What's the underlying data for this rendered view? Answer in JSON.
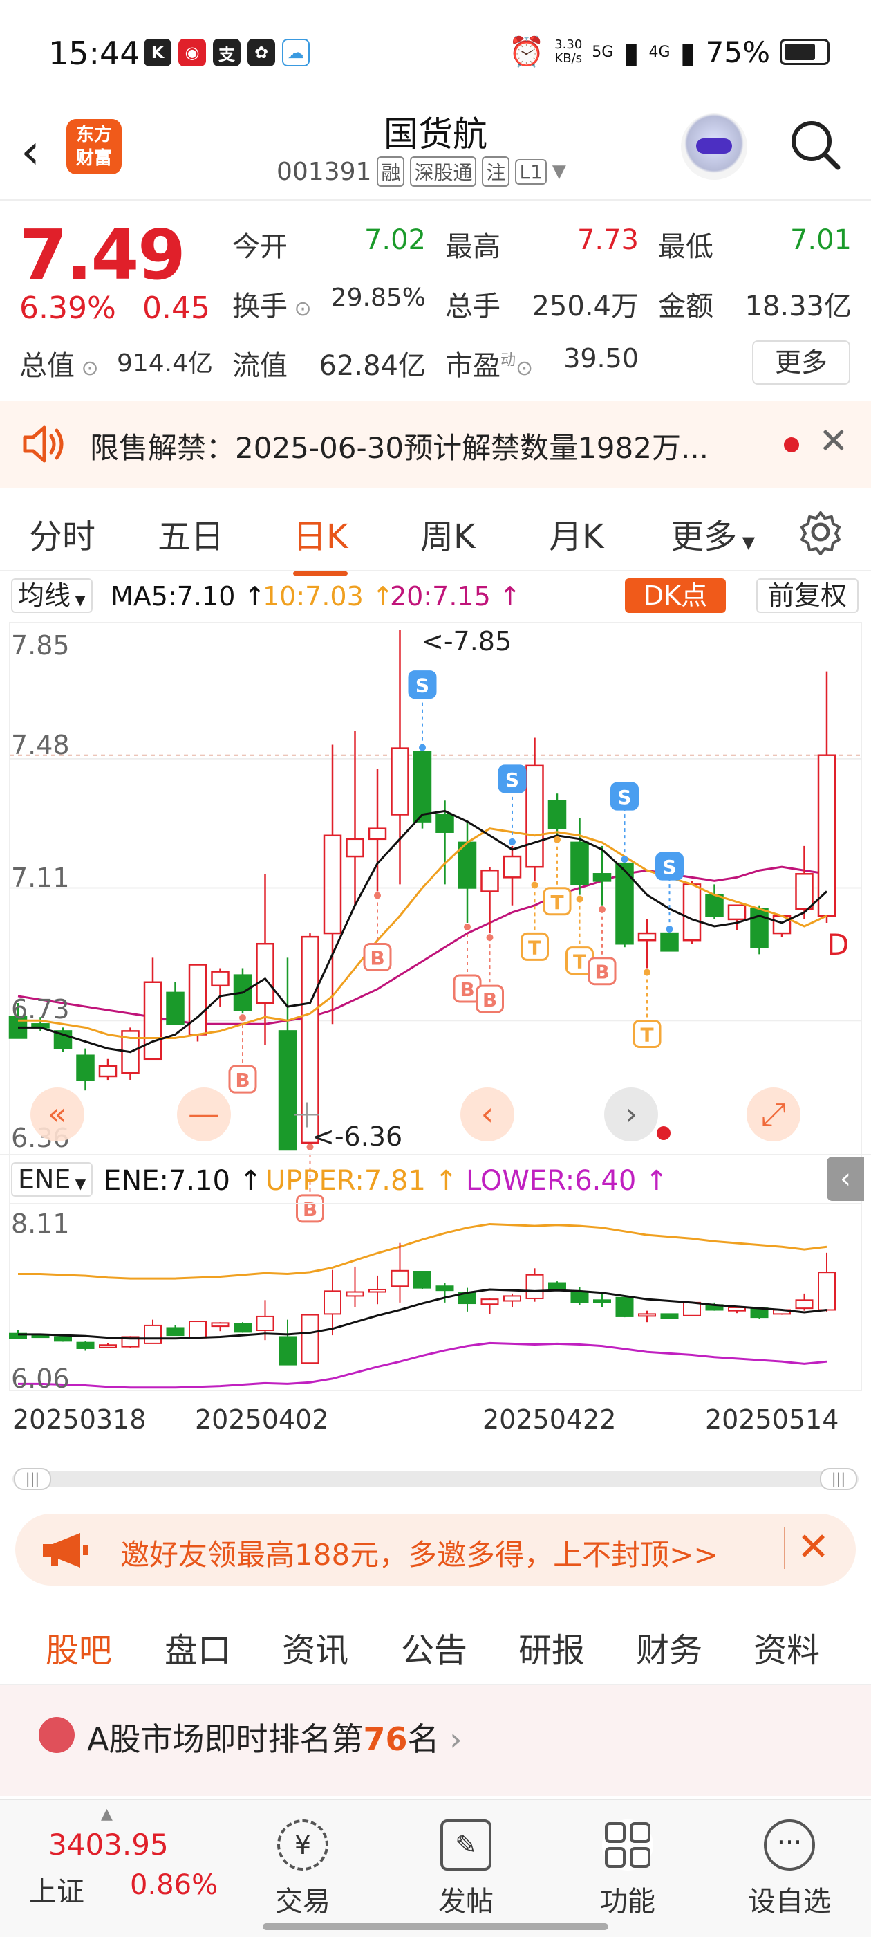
{
  "status": {
    "time": "15:44",
    "net_speed": "3.30",
    "net_unit": "KB/s",
    "net_5g": "5G",
    "net_4g": "4G",
    "battery": "75%"
  },
  "header": {
    "logo_line1": "东方",
    "logo_line2": "财富",
    "stock_name": "国货航",
    "stock_code": "001391",
    "tags": [
      "融",
      "深股通",
      "注",
      "L1"
    ]
  },
  "quote": {
    "price": "7.49",
    "change_pct": "6.39%",
    "change_amt": "0.45",
    "open_label": "今开",
    "open": "7.02",
    "high_label": "最高",
    "high": "7.73",
    "low_label": "最低",
    "low": "7.01",
    "turnover_rate_label": "换手",
    "turnover_rate": "29.85%",
    "volume_label": "总手",
    "volume": "250.4万",
    "amount_label": "金额",
    "amount": "18.33亿",
    "total_cap_label": "总值",
    "total_cap": "914.4亿",
    "float_cap_label": "流值",
    "float_cap": "62.84亿",
    "pe_label": "市盈",
    "pe_sup": "动",
    "pe": "39.50",
    "more": "更多"
  },
  "notice": {
    "text": "限售解禁：2025-06-30预计解禁数量1982万..."
  },
  "tabs": [
    "分时",
    "五日",
    "日K",
    "周K",
    "月K",
    "更多"
  ],
  "active_tab": "日K",
  "ma_bar": {
    "indicator": "均线",
    "ma5": "MA5:7.10",
    "ma10": "10:7.03",
    "ma20": "20:7.15",
    "dk": "DK点",
    "adjust": "前复权"
  },
  "ene_bar": {
    "indicator": "ENE",
    "ene": "ENE:7.10",
    "upper": "UPPER:7.81",
    "lower": "LOWER:6.40"
  },
  "colors": {
    "up": "#e0202a",
    "down": "#1a9a2a",
    "ma5": "#111111",
    "ma10": "#f0a020",
    "ma20": "#c0147a",
    "accent": "#e8561a",
    "buy": "#f07a6a",
    "sell": "#4a9ef0",
    "t": "#f5a83a"
  },
  "chart_data": {
    "type": "candlestick",
    "price_axis": {
      "top_label": "7.85",
      "mid_label": "7.48",
      "low_mid_label": "7.11",
      "lower_label": "6.73",
      "bottom_label": "6.36",
      "ylim": [
        6.36,
        7.85
      ]
    },
    "high_marker": "<-7.85",
    "low_marker": "<-6.36",
    "end_marker": "D",
    "ene_axis": {
      "top_label": "8.11",
      "bottom_label": "6.06",
      "ylim": [
        6.06,
        8.11
      ]
    },
    "dates": [
      "20250318",
      "20250402",
      "20250422",
      "20250514"
    ],
    "candles": [
      {
        "o": 6.74,
        "h": 6.78,
        "l": 6.69,
        "c": 6.68
      },
      {
        "o": 6.72,
        "h": 6.74,
        "l": 6.7,
        "c": 6.71
      },
      {
        "o": 6.7,
        "h": 6.71,
        "l": 6.64,
        "c": 6.65
      },
      {
        "o": 6.63,
        "h": 6.65,
        "l": 6.53,
        "c": 6.56
      },
      {
        "o": 6.57,
        "h": 6.62,
        "l": 6.56,
        "c": 6.6
      },
      {
        "o": 6.58,
        "h": 6.71,
        "l": 6.56,
        "c": 6.7
      },
      {
        "o": 6.62,
        "h": 6.91,
        "l": 6.62,
        "c": 6.84
      },
      {
        "o": 6.81,
        "h": 6.84,
        "l": 6.72,
        "c": 6.72
      },
      {
        "o": 6.69,
        "h": 6.88,
        "l": 6.67,
        "c": 6.89
      },
      {
        "o": 6.83,
        "h": 6.88,
        "l": 6.77,
        "c": 6.87
      },
      {
        "o": 6.86,
        "h": 6.88,
        "l": 6.75,
        "c": 6.76
      },
      {
        "o": 6.78,
        "h": 7.15,
        "l": 6.66,
        "c": 6.95
      },
      {
        "o": 6.7,
        "h": 6.91,
        "l": 6.36,
        "c": 6.36
      },
      {
        "o": 6.38,
        "h": 6.98,
        "l": 6.38,
        "c": 6.97
      },
      {
        "o": 6.98,
        "h": 7.52,
        "l": 6.72,
        "c": 7.26
      },
      {
        "o": 7.2,
        "h": 7.56,
        "l": 7.06,
        "c": 7.25
      },
      {
        "o": 7.25,
        "h": 7.45,
        "l": 7.1,
        "c": 7.28
      },
      {
        "o": 7.32,
        "h": 7.85,
        "l": 7.12,
        "c": 7.51
      },
      {
        "o": 7.5,
        "h": 7.5,
        "l": 7.28,
        "c": 7.3
      },
      {
        "o": 7.32,
        "h": 7.36,
        "l": 7.12,
        "c": 7.27
      },
      {
        "o": 7.24,
        "h": 7.3,
        "l": 7.01,
        "c": 7.11
      },
      {
        "o": 7.1,
        "h": 7.17,
        "l": 6.98,
        "c": 7.16
      },
      {
        "o": 7.14,
        "h": 7.23,
        "l": 7.06,
        "c": 7.2
      },
      {
        "o": 7.17,
        "h": 7.54,
        "l": 7.13,
        "c": 7.46
      },
      {
        "o": 7.36,
        "h": 7.38,
        "l": 7.26,
        "c": 7.28
      },
      {
        "o": 7.24,
        "h": 7.31,
        "l": 7.09,
        "c": 7.12
      },
      {
        "o": 7.15,
        "h": 7.23,
        "l": 7.06,
        "c": 7.13
      },
      {
        "o": 7.18,
        "h": 7.18,
        "l": 6.94,
        "c": 6.95
      },
      {
        "o": 6.96,
        "h": 7.02,
        "l": 6.88,
        "c": 6.98
      },
      {
        "o": 6.98,
        "h": 6.98,
        "l": 6.94,
        "c": 6.93
      },
      {
        "o": 6.96,
        "h": 7.13,
        "l": 6.95,
        "c": 7.12
      },
      {
        "o": 7.09,
        "h": 7.12,
        "l": 7.02,
        "c": 7.03
      },
      {
        "o": 7.02,
        "h": 7.06,
        "l": 6.99,
        "c": 7.06
      },
      {
        "o": 7.05,
        "h": 7.06,
        "l": 6.92,
        "c": 6.94
      },
      {
        "o": 6.98,
        "h": 7.0,
        "l": 6.97,
        "c": 7.03
      },
      {
        "o": 7.05,
        "h": 7.23,
        "l": 7.02,
        "c": 7.15
      },
      {
        "o": 7.03,
        "h": 7.73,
        "l": 7.01,
        "c": 7.49
      }
    ],
    "ma5": [
      6.71,
      6.71,
      6.69,
      6.67,
      6.65,
      6.64,
      6.67,
      6.69,
      6.74,
      6.8,
      6.81,
      6.85,
      6.77,
      6.78,
      6.92,
      7.06,
      7.18,
      7.25,
      7.32,
      7.33,
      7.3,
      7.26,
      7.22,
      7.24,
      7.26,
      7.25,
      7.22,
      7.16,
      7.09,
      7.05,
      7.02,
      7.0,
      7.01,
      7.03,
      7.01,
      7.04,
      7.1
    ],
    "ma10": [
      6.73,
      6.73,
      6.72,
      6.71,
      6.69,
      6.68,
      6.68,
      6.68,
      6.69,
      6.7,
      6.72,
      6.74,
      6.73,
      6.75,
      6.8,
      6.88,
      6.96,
      7.03,
      7.11,
      7.18,
      7.24,
      7.28,
      7.27,
      7.26,
      7.27,
      7.26,
      7.24,
      7.2,
      7.16,
      7.14,
      7.12,
      7.09,
      7.07,
      7.05,
      7.03,
      7.0,
      7.03
    ],
    "ma20": [
      6.8,
      6.79,
      6.78,
      6.77,
      6.76,
      6.75,
      6.74,
      6.73,
      6.72,
      6.72,
      6.72,
      6.72,
      6.73,
      6.74,
      6.76,
      6.79,
      6.82,
      6.86,
      6.9,
      6.94,
      6.98,
      7.01,
      7.04,
      7.06,
      7.09,
      7.11,
      7.13,
      7.15,
      7.16,
      7.15,
      7.14,
      7.13,
      7.14,
      7.16,
      7.17,
      7.16,
      7.15
    ],
    "signals": [
      {
        "type": "B",
        "i": 10
      },
      {
        "type": "B",
        "i": 13
      },
      {
        "type": "B",
        "i": 16
      },
      {
        "type": "S",
        "i": 18
      },
      {
        "type": "B",
        "i": 20
      },
      {
        "type": "B",
        "i": 21
      },
      {
        "type": "S",
        "i": 22
      },
      {
        "type": "T",
        "i": 23
      },
      {
        "type": "T",
        "i": 24
      },
      {
        "type": "T",
        "i": 25
      },
      {
        "type": "B",
        "i": 26
      },
      {
        "type": "S",
        "i": 27
      },
      {
        "type": "T",
        "i": 28
      },
      {
        "type": "S",
        "i": 29
      }
    ]
  },
  "promo": {
    "text": "邀好友领最高188元，多邀多得，上不封顶>>"
  },
  "feature_tabs": [
    "股吧",
    "盘口",
    "资讯",
    "公告",
    "研报",
    "财务",
    "资料"
  ],
  "rank": {
    "prefix": "A股市场即时排名第",
    "number": "76",
    "suffix": "名"
  },
  "bottom_nav": {
    "index_value": "3403.95",
    "index_name": "上证",
    "index_change": "0.86%",
    "items": [
      "交易",
      "发帖",
      "功能",
      "设自选"
    ]
  }
}
